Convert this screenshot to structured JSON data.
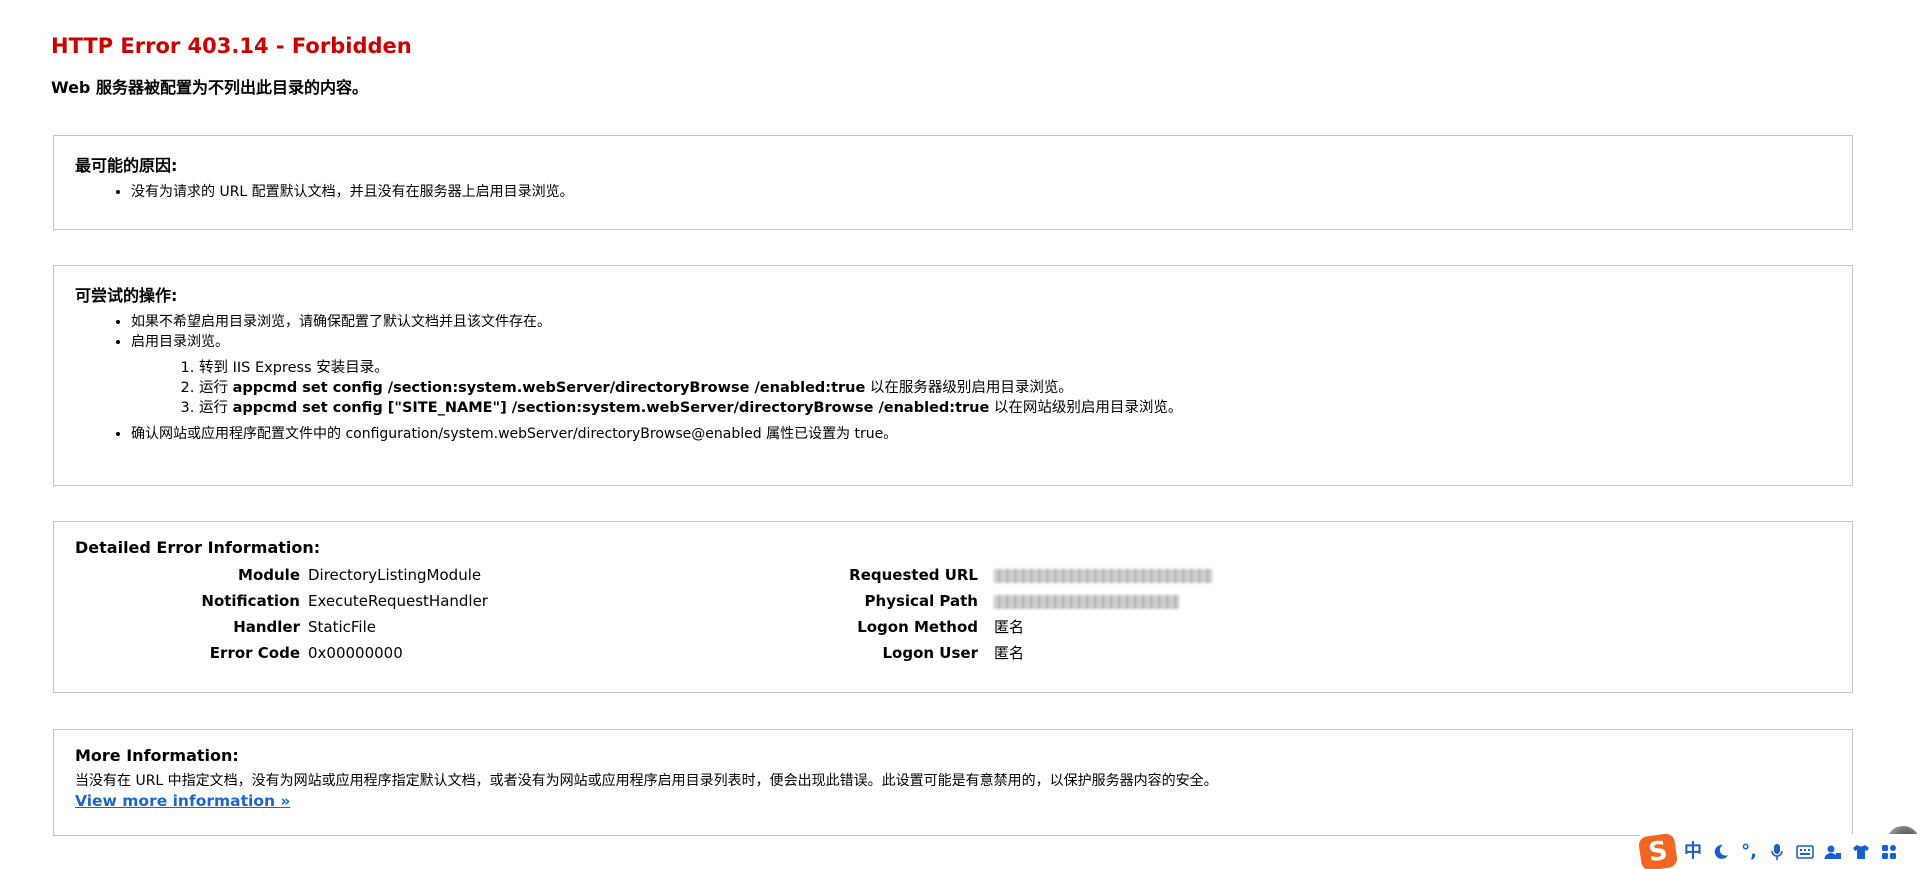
{
  "header": {
    "title": "HTTP Error 403.14 - Forbidden",
    "subtitle": "Web 服务器被配置为不列出此目录的内容。"
  },
  "causes": {
    "heading": "最可能的原因:",
    "items": [
      "没有为请求的 URL 配置默认文档，并且没有在服务器上启用目录浏览。"
    ]
  },
  "actions": {
    "heading": "可尝试的操作:",
    "item1": "如果不希望启用目录浏览，请确保配置了默认文档并且该文件存在。",
    "item2": "启用目录浏览。",
    "steps": [
      {
        "prefix": "转到 IIS Express 安装目录。",
        "cmd": "",
        "suffix": ""
      },
      {
        "prefix": "运行 ",
        "cmd": "appcmd set config /section:system.webServer/directoryBrowse /enabled:true",
        "suffix": " 以在服务器级别启用目录浏览。"
      },
      {
        "prefix": "运行 ",
        "cmd": "appcmd set config [\"SITE_NAME\"] /section:system.webServer/directoryBrowse /enabled:true",
        "suffix": " 以在网站级别启用目录浏览。"
      }
    ],
    "item3": "确认网站或应用程序配置文件中的 configuration/system.webServer/directoryBrowse@enabled 属性已设置为 true。"
  },
  "details": {
    "heading": "Detailed Error Information:",
    "left": [
      {
        "label": "Module",
        "value": "DirectoryListingModule"
      },
      {
        "label": "Notification",
        "value": "ExecuteRequestHandler"
      },
      {
        "label": "Handler",
        "value": "StaticFile"
      },
      {
        "label": "Error Code",
        "value": "0x00000000"
      }
    ],
    "right": [
      {
        "label": "Requested URL",
        "value": ""
      },
      {
        "label": "Physical Path",
        "value": ""
      },
      {
        "label": "Logon Method",
        "value": "匿名"
      },
      {
        "label": "Logon User",
        "value": "匿名"
      }
    ]
  },
  "more": {
    "heading": "More Information:",
    "text": "当没有在 URL 中指定文档，没有为网站或应用程序指定默认文档，或者没有为网站或应用程序启用目录列表时，便会出现此错误。此设置可能是有意禁用的，以保护服务器内容的安全。",
    "link": "View more information »"
  },
  "ime": {
    "logo": "S",
    "mode": "中",
    "punct": "°,"
  },
  "colors": {
    "title": "#cc0000",
    "link": "#1a66cc",
    "box_border": "#c4c4c4",
    "ime_accent": "#1a5fcf",
    "ime_logo": "#f26522"
  }
}
